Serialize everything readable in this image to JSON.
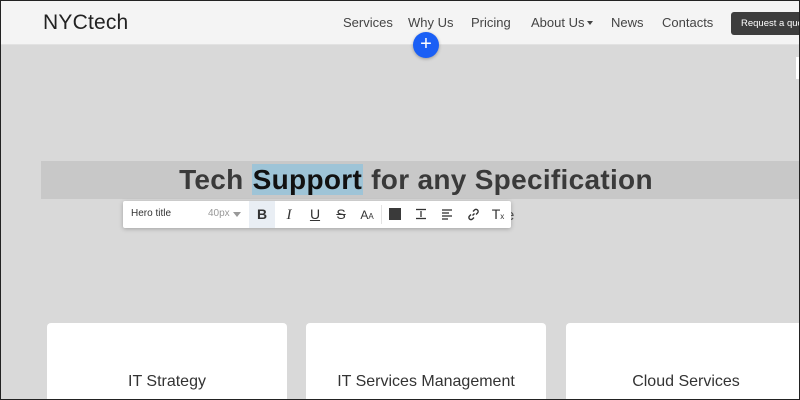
{
  "header": {
    "logo": "NYCtech",
    "nav": [
      {
        "label": "Services"
      },
      {
        "label": "Why Us"
      },
      {
        "label": "Pricing"
      },
      {
        "label": "About Us",
        "has_dropdown": true
      },
      {
        "label": "News"
      },
      {
        "label": "Contacts"
      }
    ],
    "cta_label": "Request a quote",
    "add_block_label": "+"
  },
  "hero": {
    "title_before": "Tech ",
    "title_selected": "Support",
    "title_after": " for any Specification",
    "subtitle_fragment": "e"
  },
  "toolbar": {
    "text_style": "Hero title",
    "font_size": "40px",
    "buttons": [
      {
        "name": "bold-icon",
        "glyph": "B",
        "active": true
      },
      {
        "name": "italic-icon",
        "glyph": "I"
      },
      {
        "name": "underline-icon",
        "glyph": "U"
      },
      {
        "name": "strikethrough-icon",
        "glyph": "S"
      },
      {
        "name": "font-case-icon",
        "glyph": "AA"
      },
      {
        "name": "text-color-icon",
        "color": "#3a3a3a"
      },
      {
        "name": "line-height-icon"
      },
      {
        "name": "align-left-icon"
      },
      {
        "name": "link-icon"
      },
      {
        "name": "clear-format-icon",
        "glyph": "T"
      }
    ]
  },
  "cards": [
    {
      "title": "IT Strategy"
    },
    {
      "title": "IT Services Management"
    },
    {
      "title": "Cloud Services"
    }
  ],
  "colors": {
    "accent": "#1a5ff5",
    "selection": "#9ec4d7",
    "cta_bg": "#3d3d3d",
    "page_bg": "#d9d9d9"
  }
}
